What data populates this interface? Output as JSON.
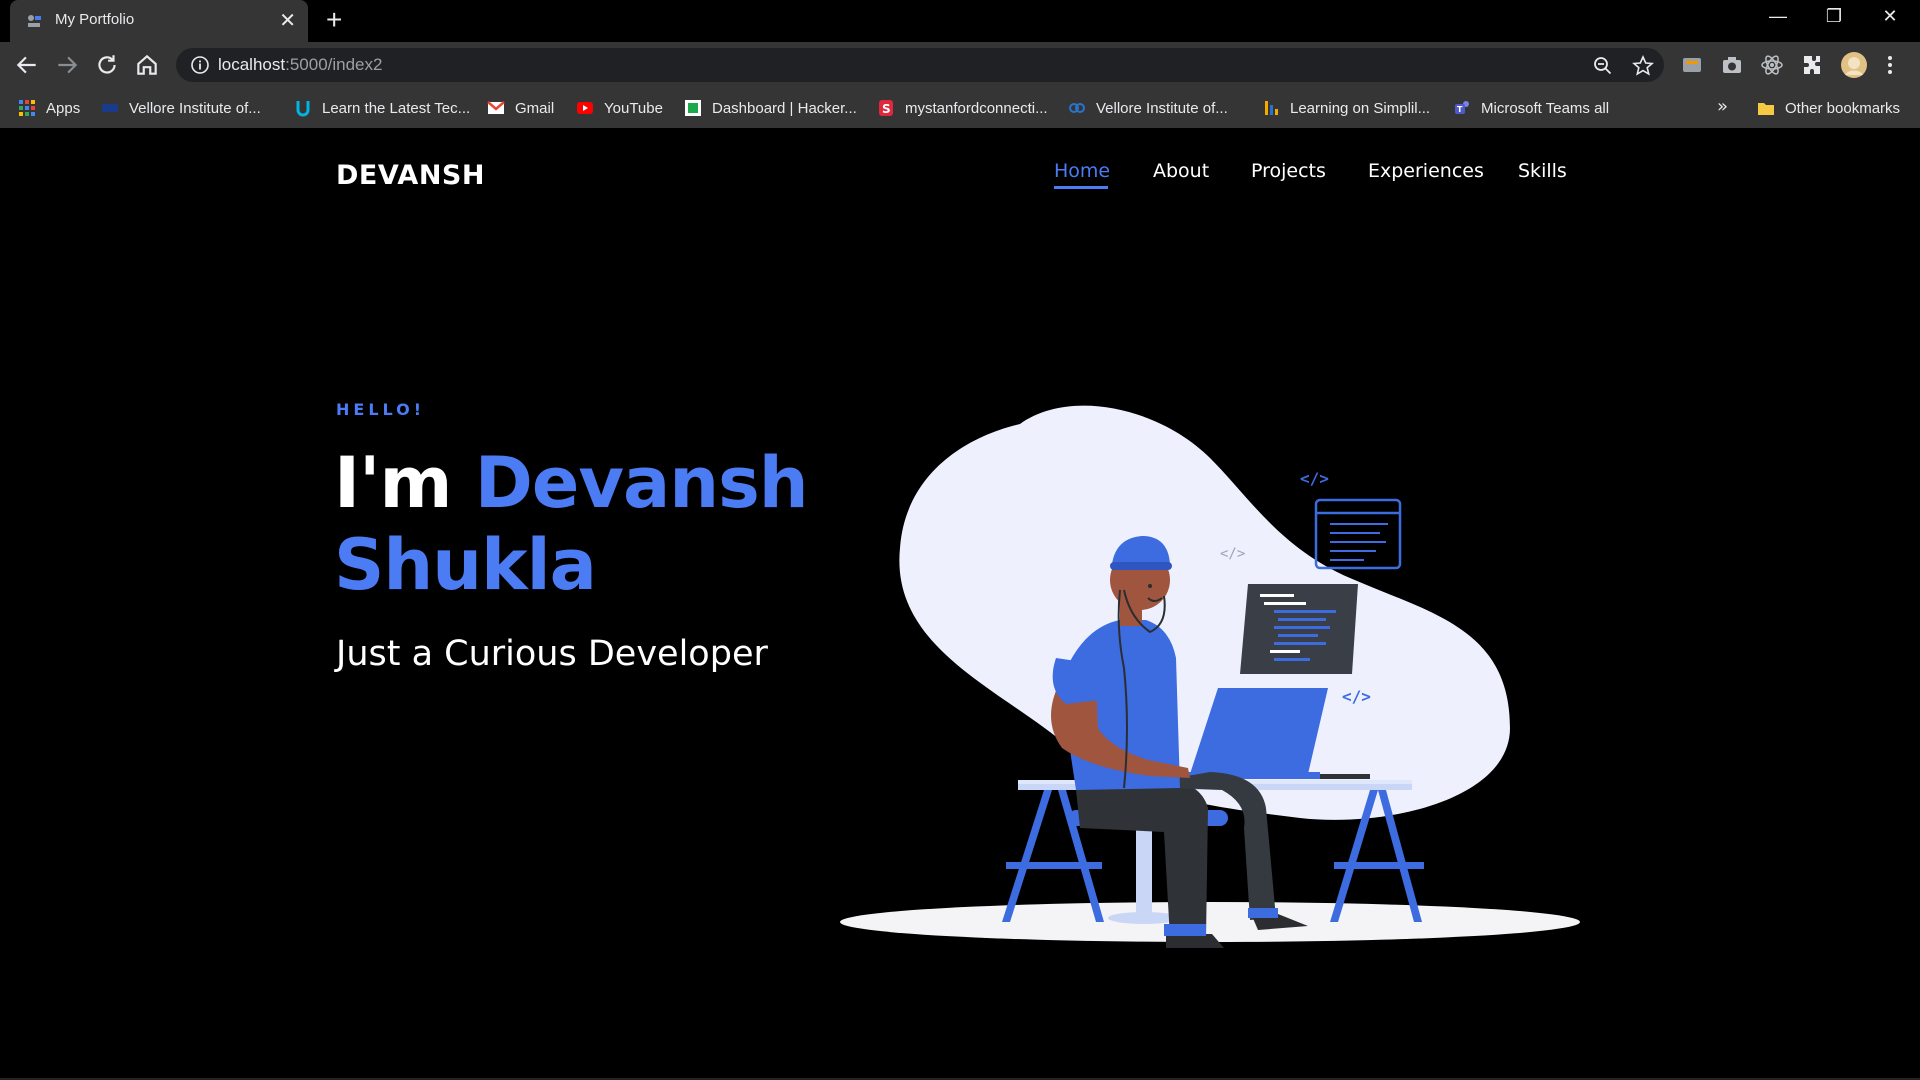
{
  "browser": {
    "tab": {
      "title": "My Portfolio",
      "close_glyph": "✕"
    },
    "new_tab_glyph": "+",
    "window_controls": {
      "minimize": "—",
      "restore": "❐",
      "close": "✕"
    },
    "url": {
      "host": "localhost",
      "path": ":5000/index2"
    },
    "bookmarks": [
      {
        "label": "Apps",
        "icon": "apps-grid-icon"
      },
      {
        "label": "Vellore Institute of...",
        "icon": "vit-icon"
      },
      {
        "label": "Learn the Latest Tec...",
        "icon": "udacity-icon"
      },
      {
        "label": "Gmail",
        "icon": "gmail-icon"
      },
      {
        "label": "YouTube",
        "icon": "youtube-icon"
      },
      {
        "label": "Dashboard | Hacker...",
        "icon": "hackerrank-icon"
      },
      {
        "label": "mystanfordconnecti...",
        "icon": "stanford-icon"
      },
      {
        "label": "Vellore Institute of...",
        "icon": "coursera-icon"
      },
      {
        "label": "Learning on Simplil...",
        "icon": "simplilearn-icon"
      },
      {
        "label": "Microsoft Teams all",
        "icon": "teams-icon"
      }
    ],
    "bookmarks_overflow": "»",
    "other_bookmarks": "Other bookmarks"
  },
  "site": {
    "logo": "DEVANSH",
    "nav": [
      "Home",
      "About",
      "Projects",
      "Experiences",
      "Skills"
    ],
    "active_nav": "Home",
    "hero": {
      "greeting": "HELLO!",
      "im": "I'm",
      "first_name": "Devansh",
      "last_name": "Shukla",
      "tagline": "Just a Curious Developer"
    },
    "illustration": {
      "code_tag_1": "</>",
      "code_tag_2": "</>",
      "code_tag_3": "</>"
    }
  },
  "colors": {
    "accent": "#4b7cf3",
    "background": "#000000",
    "blob": "#eef1fd"
  }
}
